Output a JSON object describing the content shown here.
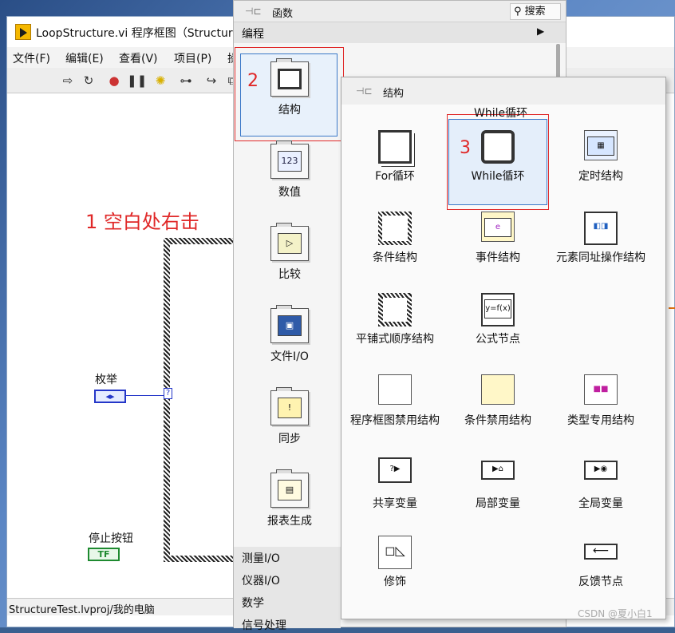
{
  "window": {
    "title": "LoopStructure.vi 程序框图（StructureT",
    "menu": [
      "文件(F)",
      "编辑(E)",
      "查看(V)",
      "项目(P)",
      "操"
    ],
    "status": "StructureTest.lvproj/我的电脑"
  },
  "diagram": {
    "annotation": "1 空白处右击",
    "enum_label": "枚举",
    "enum_value": "◂▸",
    "case_selector": "?",
    "stop_label": "停止按钮",
    "stop_value": "TF"
  },
  "palette": {
    "title": "函数",
    "search": "搜索",
    "programming": "编程",
    "step_num": "2",
    "categories": [
      {
        "label": "结构",
        "icon": "structures-icon"
      },
      {
        "label": "数值",
        "icon": "numeric-icon",
        "glyph": "123"
      },
      {
        "label": "比较",
        "icon": "comparison-icon"
      },
      {
        "label": "文件I/O",
        "icon": "file-io-icon"
      },
      {
        "label": "同步",
        "icon": "sync-icon"
      },
      {
        "label": "报表生成",
        "icon": "report-icon"
      }
    ],
    "bottom": [
      "测量I/O",
      "仪器I/O",
      "数学",
      "信号处理"
    ]
  },
  "structures": {
    "title": "结构",
    "tooltip": "While循环",
    "step_num": "3",
    "items": [
      {
        "label": "For循环"
      },
      {
        "label": "While循环"
      },
      {
        "label": "定时结构"
      },
      {
        "label": "条件结构"
      },
      {
        "label": "事件结构"
      },
      {
        "label": "元素同址操作结构"
      },
      {
        "label": "平铺式顺序结构"
      },
      {
        "label": "公式节点"
      },
      {
        "label": "程序框图禁用结构"
      },
      {
        "label": "条件禁用结构"
      },
      {
        "label": "类型专用结构"
      },
      {
        "label": "共享变量"
      },
      {
        "label": "局部变量"
      },
      {
        "label": "全局变量"
      },
      {
        "label": "修饰"
      },
      {
        "label": "反馈节点"
      }
    ]
  },
  "watermark": "CSDN @夏小白1"
}
